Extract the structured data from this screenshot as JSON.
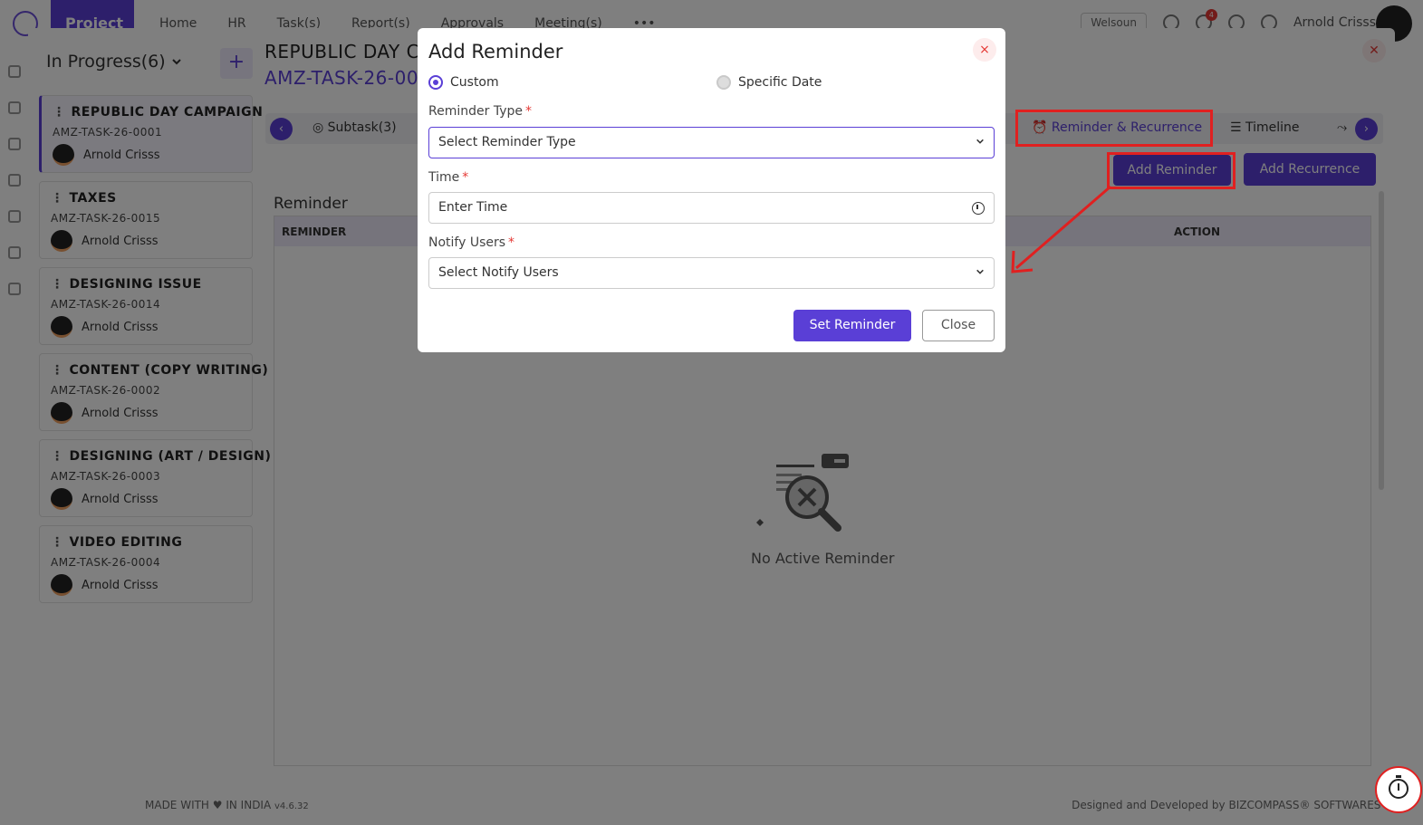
{
  "app": {
    "brand": "Project",
    "nav": [
      "Home",
      "HR",
      "Task(s)",
      "Report(s)",
      "Approvals",
      "Meeting(s)"
    ],
    "nav_more": "•••",
    "workspace": "Welsoun",
    "notification_count": "4",
    "user_name": "Arnold Crisss"
  },
  "sidebar": {
    "status_label": "In Progress(6)",
    "add_label": "+",
    "tasks": [
      {
        "title": "REPUBLIC DAY CAMPAIGN",
        "code": "AMZ-TASK-26-0001",
        "assignee": "Arnold Crisss"
      },
      {
        "title": "TAXES",
        "code": "AMZ-TASK-26-0015",
        "assignee": "Arnold Crisss"
      },
      {
        "title": "DESIGNING ISSUE",
        "code": "AMZ-TASK-26-0014",
        "assignee": "Arnold Crisss"
      },
      {
        "title": "CONTENT (COPY WRITING)",
        "code": "AMZ-TASK-26-0002",
        "assignee": "Arnold Crisss"
      },
      {
        "title": "DESIGNING (ART / DESIGN)",
        "code": "AMZ-TASK-26-0003",
        "assignee": "Arnold Crisss"
      },
      {
        "title": "VIDEO EDITING",
        "code": "AMZ-TASK-26-0004",
        "assignee": "Arnold Crisss"
      }
    ]
  },
  "task_detail": {
    "title": "REPUBLIC DAY C",
    "code": "AMZ-TASK-26-00",
    "tabs": {
      "subtask": "Subtask(3)",
      "reminder": "Reminder & Recurrence",
      "timeline": "Timeline"
    },
    "add_reminder": "Add Reminder",
    "add_recurrence": "Add Recurrence",
    "section_title": "Reminder",
    "columns": {
      "reminder": "REMINDER",
      "action": "ACTION"
    },
    "empty_text": "No Active Reminder"
  },
  "footer": {
    "made_with": "MADE WITH ♥ IN INDIA",
    "version": "v4.6.32",
    "designed_by": "Designed and Developed by BIZCOMPASS® SOFTWARES PVT"
  },
  "modal": {
    "title": "Add Reminder",
    "close_symbol": "×",
    "options": {
      "custom": "Custom",
      "specific_date": "Specific Date"
    },
    "selected_option": "custom",
    "reminder_type": {
      "label": "Reminder Type",
      "placeholder": "Select Reminder Type"
    },
    "time": {
      "label": "Time",
      "placeholder": "Enter Time"
    },
    "notify_users": {
      "label": "Notify Users",
      "placeholder": "Select Notify Users"
    },
    "required_mark": "*",
    "set_button": "Set Reminder",
    "close_button": "Close"
  },
  "colors": {
    "accent": "#5a3fd6",
    "annotation": "#e02020",
    "danger": "#e53935"
  }
}
